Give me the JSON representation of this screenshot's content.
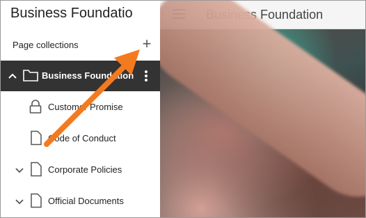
{
  "sidebar": {
    "title": "Business Foundatio",
    "section_label": "Page collections",
    "add_button": "+",
    "items": [
      {
        "label": "Business Foundation",
        "icon": "folder-icon",
        "expanded": true,
        "active": true
      },
      {
        "label": "Customer Promise",
        "icon": "lock-icon"
      },
      {
        "label": "Code of Conduct",
        "icon": "page-icon"
      },
      {
        "label": "Corporate Policies",
        "icon": "page-icon",
        "expandable": true
      },
      {
        "label": "Official Documents",
        "icon": "page-icon",
        "expandable": true
      }
    ]
  },
  "topbar": {
    "title": "Business Foundation"
  },
  "colors": {
    "active_row": "#333333",
    "arrow": "#f47a1f"
  }
}
